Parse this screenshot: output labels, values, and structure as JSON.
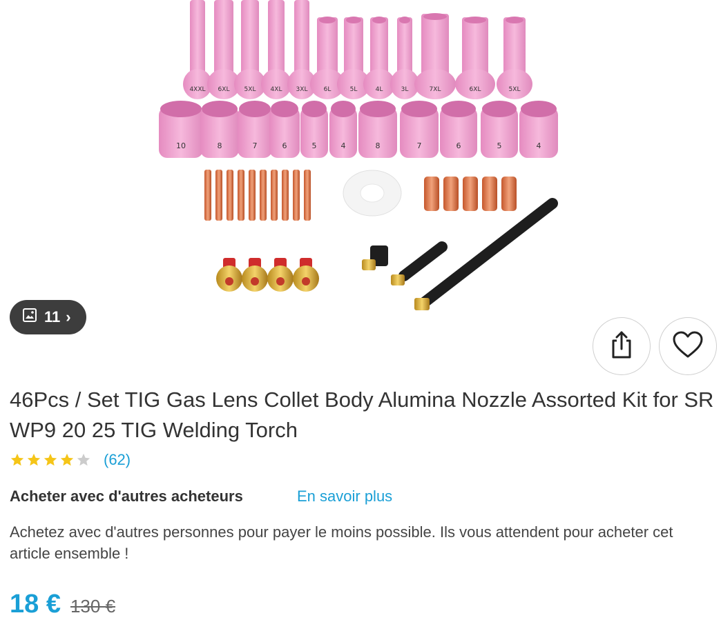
{
  "gallery": {
    "image_count": "11",
    "chevron": "›"
  },
  "product": {
    "title": "46Pcs / Set TIG Gas Lens Collet Body Alumina Nozzle Assorted Kit for SR WP9 20 25 TIG Welding Torch",
    "rating": 4,
    "rating_max": 5,
    "review_count": "(62)",
    "price": "18 €",
    "old_price": "130 €"
  },
  "group_buy": {
    "title": "Acheter avec d'autres acheteurs",
    "learn_more": "En savoir plus",
    "description": "Achetez avec d'autres personnes pour payer le moins possible. Ils vous attendent pour acheter cet article ensemble !"
  },
  "image_labels": {
    "long_cups": [
      "4XXL",
      "6XL",
      "5XL",
      "4XL",
      "3XL",
      "6L",
      "5L",
      "4L",
      "3L",
      "7XL",
      "6XL",
      "5XL"
    ],
    "short_cups": [
      "10",
      "8",
      "7",
      "6",
      "5",
      "4",
      "8",
      "7",
      "6",
      "5",
      "4"
    ]
  },
  "colors": {
    "accent": "#1a9fd6",
    "star": "#f5c518",
    "star_empty": "#cccccc",
    "nozzle": "#f0a3cf"
  }
}
